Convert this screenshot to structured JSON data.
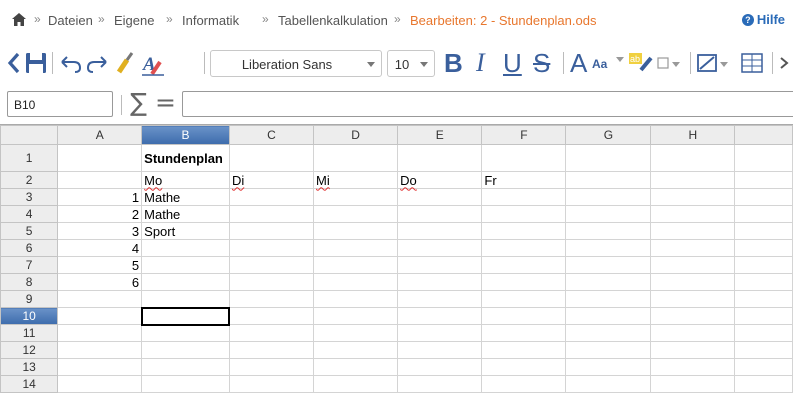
{
  "breadcrumb": {
    "items": [
      "Dateien",
      "Eigene",
      "Informatik",
      "Tabellenkalkulation"
    ],
    "current": "Bearbeiten: 2 - Stundenplan.ods",
    "separator": "»",
    "help_label": "Hilfe"
  },
  "toolbar": {
    "font_name": "Liberation Sans",
    "font_size": "10",
    "bold_glyph": "B",
    "italic_glyph": "I",
    "underline_glyph": "U",
    "strike_glyph": "S",
    "bigA_glyph": "A",
    "aa_glyph": "Aa",
    "accent_color": "#3a5f9c"
  },
  "formula_bar": {
    "name_box": "B10",
    "sigma": "∑",
    "equals": "=",
    "value": ""
  },
  "sheet": {
    "columns": [
      "",
      "A",
      "B",
      "C",
      "D",
      "E",
      "F",
      "G",
      "H",
      ""
    ],
    "selected_column": "B",
    "selected_row": "10",
    "rows": [
      {
        "n": "1",
        "A": "",
        "B": "Stundenplan"
      },
      {
        "n": "2",
        "A": "",
        "B": "Mo",
        "C": "Di",
        "D": "Mi",
        "E": "Do",
        "F": "Fr"
      },
      {
        "n": "3",
        "A": "1",
        "B": "Mathe"
      },
      {
        "n": "4",
        "A": "2",
        "B": "Mathe"
      },
      {
        "n": "5",
        "A": "3",
        "B": "Sport"
      },
      {
        "n": "6",
        "A": "4",
        "B": ""
      },
      {
        "n": "7",
        "A": "5",
        "B": ""
      },
      {
        "n": "8",
        "A": "6",
        "B": ""
      },
      {
        "n": "9",
        "A": "",
        "B": ""
      },
      {
        "n": "10",
        "A": "",
        "B": ""
      },
      {
        "n": "11",
        "A": "",
        "B": ""
      },
      {
        "n": "12",
        "A": "",
        "B": ""
      },
      {
        "n": "13",
        "A": "",
        "B": ""
      },
      {
        "n": "14",
        "A": "",
        "B": ""
      }
    ]
  },
  "colors": {
    "breadcrumb_active": "#e8772e",
    "help": "#2a6bb8",
    "selection_header": "#3d6cac"
  }
}
